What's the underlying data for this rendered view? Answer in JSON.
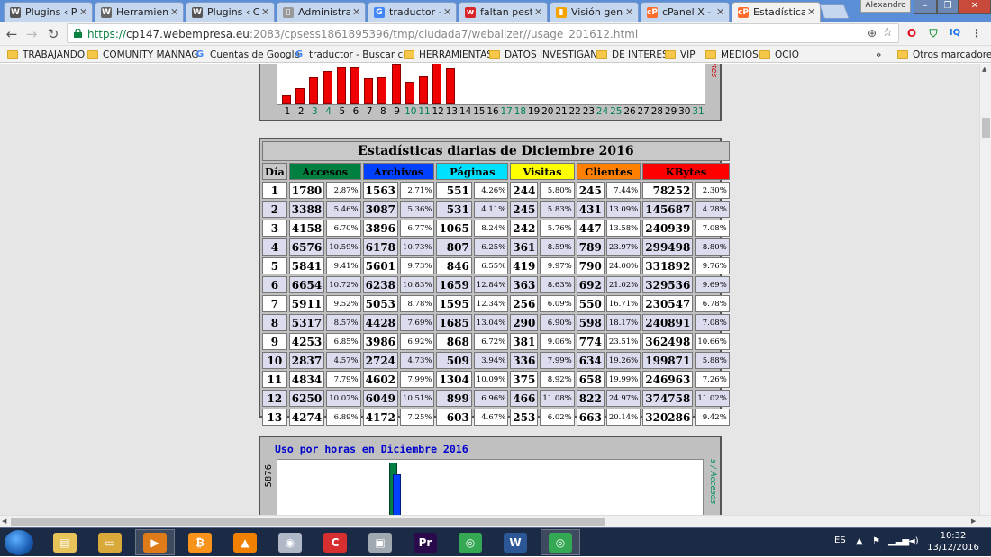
{
  "browser": {
    "tabs": [
      {
        "title": "Plugins ‹ Pr",
        "icon": "wordpress-icon",
        "color": "#555555",
        "glyph": "W"
      },
      {
        "title": "Herramienta",
        "icon": "wordpress-icon",
        "color": "#666666",
        "glyph": "W"
      },
      {
        "title": "Plugins ‹ Cr",
        "icon": "wordpress-icon",
        "color": "#555555",
        "glyph": "W"
      },
      {
        "title": "Administra",
        "icon": "document-icon",
        "color": "#999999",
        "glyph": "▯"
      },
      {
        "title": "traductor -",
        "icon": "google-icon",
        "color": "#4285f4",
        "glyph": "G"
      },
      {
        "title": "faltan pesta",
        "icon": "webempresa-icon",
        "color": "#d9262a",
        "glyph": "w"
      },
      {
        "title": "Visión gene",
        "icon": "analytics-icon",
        "color": "#f4a300",
        "glyph": "▮"
      },
      {
        "title": "cPanel X - V",
        "icon": "cpanel-icon",
        "color": "#ff6c2c",
        "glyph": "cP"
      },
      {
        "title": "Estadísticas",
        "icon": "cpanel-icon",
        "color": "#ff6c2c",
        "glyph": "cP",
        "active": true
      }
    ],
    "user": "Alexandro",
    "url": {
      "scheme": "https://",
      "host": "cp147.webempresa.eu",
      "rest": ":2083/cpsess1861895396/tmp/ciudada7/webalizer//usage_201612.html"
    },
    "bookmarks": [
      {
        "label": "TRABAJANDO",
        "type": "folder"
      },
      {
        "label": "COMUNITY MANNAG",
        "type": "folder"
      },
      {
        "label": "Cuentas de Google",
        "type": "google"
      },
      {
        "label": "traductor - Buscar cor",
        "type": "google"
      },
      {
        "label": "HERRAMIENTAS",
        "type": "folder"
      },
      {
        "label": "DATOS INVESTIGAND",
        "type": "folder"
      },
      {
        "label": "DE INTERÉS",
        "type": "folder"
      },
      {
        "label": "VIP",
        "type": "folder"
      },
      {
        "label": "MEDIOS",
        "type": "folder"
      },
      {
        "label": "OCIO",
        "type": "folder"
      }
    ],
    "bookmarks_more": "»",
    "other_bookmarks": "Otros marcadores"
  },
  "top_chart": {
    "ylabel": "KBytes",
    "days": [
      "1",
      "2",
      "3",
      "4",
      "5",
      "6",
      "7",
      "8",
      "9",
      "10",
      "11",
      "12",
      "13",
      "14",
      "15",
      "16",
      "17",
      "18",
      "19",
      "20",
      "21",
      "22",
      "23",
      "24",
      "25",
      "26",
      "27",
      "28",
      "29",
      "30",
      "31"
    ],
    "weekend_days": [
      "3",
      "4",
      "10",
      "11",
      "17",
      "18",
      "24",
      "25",
      "31"
    ],
    "values": [
      78252,
      145687,
      240939,
      299498,
      331892,
      329536,
      230547,
      240891,
      362498,
      199871,
      246963,
      374758,
      320286
    ],
    "max": 374758
  },
  "daily": {
    "title": "Estadísticas diarias de Diciembre 2016",
    "headers": {
      "dia": "Día",
      "accesos": "Accesos",
      "archivos": "Archivos",
      "paginas": "Páginas",
      "visitas": "Visitas",
      "clientes": "Clientes",
      "kbytes": "KBytes"
    },
    "colors": {
      "accesos": "#008040",
      "archivos": "#0040ff",
      "paginas": "#00e0ff",
      "visitas": "#ffff00",
      "clientes": "#ff8000",
      "kbytes": "#ff0000"
    },
    "rows": [
      {
        "dia": "1",
        "acc": "1780",
        "accp": "2.87%",
        "arc": "1563",
        "arcp": "2.71%",
        "pag": "551",
        "pagp": "4.26%",
        "vis": "244",
        "visp": "5.80%",
        "cli": "245",
        "clip": "7.44%",
        "kb": "78252",
        "kbp": "2.30%"
      },
      {
        "dia": "2",
        "acc": "3388",
        "accp": "5.46%",
        "arc": "3087",
        "arcp": "5.36%",
        "pag": "531",
        "pagp": "4.11%",
        "vis": "245",
        "visp": "5.83%",
        "cli": "431",
        "clip": "13.09%",
        "kb": "145687",
        "kbp": "4.28%"
      },
      {
        "dia": "3",
        "acc": "4158",
        "accp": "6.70%",
        "arc": "3896",
        "arcp": "6.77%",
        "pag": "1065",
        "pagp": "8.24%",
        "vis": "242",
        "visp": "5.76%",
        "cli": "447",
        "clip": "13.58%",
        "kb": "240939",
        "kbp": "7.08%"
      },
      {
        "dia": "4",
        "acc": "6576",
        "accp": "10.59%",
        "arc": "6178",
        "arcp": "10.73%",
        "pag": "807",
        "pagp": "6.25%",
        "vis": "361",
        "visp": "8.59%",
        "cli": "789",
        "clip": "23.97%",
        "kb": "299498",
        "kbp": "8.80%"
      },
      {
        "dia": "5",
        "acc": "5841",
        "accp": "9.41%",
        "arc": "5601",
        "arcp": "9.73%",
        "pag": "846",
        "pagp": "6.55%",
        "vis": "419",
        "visp": "9.97%",
        "cli": "790",
        "clip": "24.00%",
        "kb": "331892",
        "kbp": "9.76%"
      },
      {
        "dia": "6",
        "acc": "6654",
        "accp": "10.72%",
        "arc": "6238",
        "arcp": "10.83%",
        "pag": "1659",
        "pagp": "12.84%",
        "vis": "363",
        "visp": "8.63%",
        "cli": "692",
        "clip": "21.02%",
        "kb": "329536",
        "kbp": "9.69%"
      },
      {
        "dia": "7",
        "acc": "5911",
        "accp": "9.52%",
        "arc": "5053",
        "arcp": "8.78%",
        "pag": "1595",
        "pagp": "12.34%",
        "vis": "256",
        "visp": "6.09%",
        "cli": "550",
        "clip": "16.71%",
        "kb": "230547",
        "kbp": "6.78%"
      },
      {
        "dia": "8",
        "acc": "5317",
        "accp": "8.57%",
        "arc": "4428",
        "arcp": "7.69%",
        "pag": "1685",
        "pagp": "13.04%",
        "vis": "290",
        "visp": "6.90%",
        "cli": "598",
        "clip": "18.17%",
        "kb": "240891",
        "kbp": "7.08%"
      },
      {
        "dia": "9",
        "acc": "4253",
        "accp": "6.85%",
        "arc": "3986",
        "arcp": "6.92%",
        "pag": "868",
        "pagp": "6.72%",
        "vis": "381",
        "visp": "9.06%",
        "cli": "774",
        "clip": "23.51%",
        "kb": "362498",
        "kbp": "10.66%"
      },
      {
        "dia": "10",
        "acc": "2837",
        "accp": "4.57%",
        "arc": "2724",
        "arcp": "4.73%",
        "pag": "509",
        "pagp": "3.94%",
        "vis": "336",
        "visp": "7.99%",
        "cli": "634",
        "clip": "19.26%",
        "kb": "199871",
        "kbp": "5.88%"
      },
      {
        "dia": "11",
        "acc": "4834",
        "accp": "7.79%",
        "arc": "4602",
        "arcp": "7.99%",
        "pag": "1304",
        "pagp": "10.09%",
        "vis": "375",
        "visp": "8.92%",
        "cli": "658",
        "clip": "19.99%",
        "kb": "246963",
        "kbp": "7.26%"
      },
      {
        "dia": "12",
        "acc": "6250",
        "accp": "10.07%",
        "arc": "6049",
        "arcp": "10.51%",
        "pag": "899",
        "pagp": "6.96%",
        "vis": "466",
        "visp": "11.08%",
        "cli": "822",
        "clip": "24.97%",
        "kb": "374758",
        "kbp": "11.02%"
      },
      {
        "dia": "13",
        "acc": "4274",
        "accp": "6.89%",
        "arc": "4172",
        "arcp": "7.25%",
        "pag": "603",
        "pagp": "4.67%",
        "vis": "253",
        "visp": "6.02%",
        "cli": "663",
        "clip": "20.14%",
        "kb": "320286",
        "kbp": "9.42%"
      }
    ]
  },
  "hourly": {
    "title": "Uso por horas en Diciembre 2016",
    "ymax_label": "5876",
    "right_label": "s / Accesos"
  },
  "taskbar": {
    "apps": [
      {
        "name": "explorer-icon",
        "color": "#e8c35a",
        "glyph": "▤"
      },
      {
        "name": "folder-icon",
        "color": "#d9a93a",
        "glyph": "▭"
      },
      {
        "name": "media-player-icon",
        "color": "#e07b1a",
        "glyph": "▶",
        "active": true
      },
      {
        "name": "bitcoin-icon",
        "color": "#f7931a",
        "glyph": "₿"
      },
      {
        "name": "vlc-icon",
        "color": "#f08000",
        "glyph": "▲"
      },
      {
        "name": "burn-disc-icon",
        "color": "#b0b8c8",
        "glyph": "◉"
      },
      {
        "name": "ccleaner-icon",
        "color": "#d83030",
        "glyph": "C"
      },
      {
        "name": "printer-icon",
        "color": "#a0a8b0",
        "glyph": "▣"
      },
      {
        "name": "premiere-icon",
        "color": "#2a0a4a",
        "glyph": "Pr"
      },
      {
        "name": "chrome-icon",
        "color": "#34a853",
        "glyph": "◎"
      },
      {
        "name": "word-icon",
        "color": "#2b5797",
        "glyph": "W"
      },
      {
        "name": "chrome-icon",
        "color": "#34a853",
        "glyph": "◎",
        "active": true
      }
    ],
    "lang": "ES",
    "time": "10:32",
    "date": "13/12/2016"
  }
}
